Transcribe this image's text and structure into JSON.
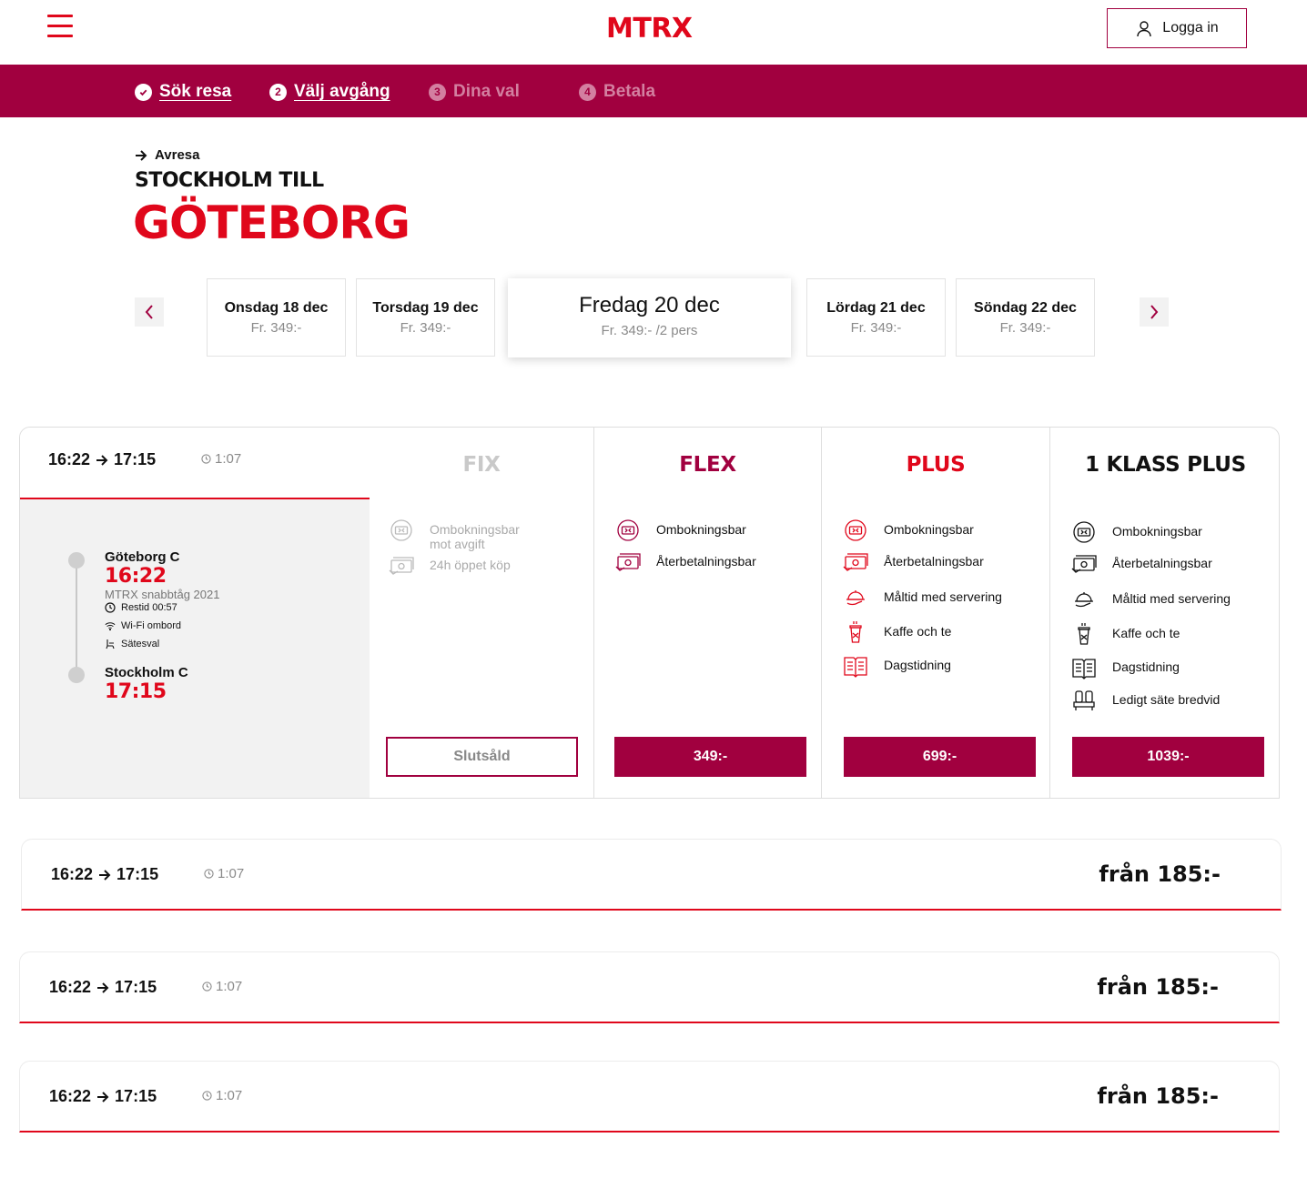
{
  "header": {
    "logo": "MTRX",
    "login_label": "Logga in"
  },
  "steps": [
    {
      "num": "✓",
      "label": "Sök resa",
      "state": "done"
    },
    {
      "num": "2",
      "label": "Välj avgång",
      "state": "current"
    },
    {
      "num": "3",
      "label": "Dina val",
      "state": "upcoming"
    },
    {
      "num": "4",
      "label": "Betala",
      "state": "upcoming"
    }
  ],
  "route": {
    "direction": "Avresa",
    "from": "STOCKHOLM TILL",
    "to": "GÖTEBORG"
  },
  "dates": [
    {
      "day": "Onsdag 18 dec",
      "price": "Fr. 349:-"
    },
    {
      "day": "Torsdag 19 dec",
      "price": "Fr. 349:-"
    },
    {
      "day": "Fredag 20 dec",
      "price": "Fr. 349:- /2 pers",
      "selected": true
    },
    {
      "day": "Lördag 21 dec",
      "price": "Fr. 349:-"
    },
    {
      "day": "Söndag 22 dec",
      "price": "Fr. 349:-"
    }
  ],
  "expanded_departure": {
    "depart": "16:22",
    "arrive": "17:15",
    "duration": "1:07",
    "origin": {
      "station": "Göteborg C",
      "time": "16:22"
    },
    "destination": {
      "station": "Stockholm C",
      "time": "17:15"
    },
    "train": "MTRX snabbtåg 2021",
    "travel_time": "Restid 00:57",
    "amenities": [
      "Wi-Fi ombord",
      "Sätesval"
    ],
    "tiers": [
      {
        "name": "FIX",
        "color": "#c9c9c9",
        "features": [
          {
            "icon": "rebook-ticket-icon",
            "text": "Ombokningsbar mot avgift"
          },
          {
            "icon": "refund-money-icon",
            "text": "24h öppet köp"
          }
        ],
        "button": "Slutsåld",
        "sold_out": true
      },
      {
        "name": "FLEX",
        "color": "#a1003f",
        "features": [
          {
            "icon": "rebook-ticket-icon",
            "text": "Ombokningsbar"
          },
          {
            "icon": "refund-money-icon",
            "text": "Återbetalningsbar"
          }
        ],
        "button": "349:-"
      },
      {
        "name": "PLUS",
        "color": "#e0071b",
        "features": [
          {
            "icon": "rebook-ticket-icon",
            "text": "Ombokningsbar"
          },
          {
            "icon": "refund-money-icon",
            "text": "Återbetalningsbar"
          },
          {
            "icon": "meal-service-icon",
            "text": "Måltid med servering"
          },
          {
            "icon": "coffee-cup-icon",
            "text": "Kaffe och te"
          },
          {
            "icon": "newspaper-icon",
            "text": "Dagstidning"
          }
        ],
        "button": "699:-"
      },
      {
        "name": "1 KLASS PLUS",
        "color": "#111111",
        "features": [
          {
            "icon": "rebook-ticket-icon",
            "text": "Ombokningsbar"
          },
          {
            "icon": "refund-money-icon",
            "text": "Återbetalningsbar"
          },
          {
            "icon": "meal-service-icon",
            "text": "Måltid med servering"
          },
          {
            "icon": "coffee-cup-icon",
            "text": "Kaffe och te"
          },
          {
            "icon": "newspaper-icon",
            "text": "Dagstidning"
          },
          {
            "icon": "empty-seat-icon",
            "text": "Ledigt säte bredvid"
          }
        ],
        "button": "1039:-"
      }
    ]
  },
  "other_departures": [
    {
      "depart": "16:22",
      "arrive": "17:15",
      "duration": "1:07",
      "price": "från 185:-"
    },
    {
      "depart": "16:22",
      "arrive": "17:15",
      "duration": "1:07",
      "price": "från 185:-"
    },
    {
      "depart": "16:22",
      "arrive": "17:15",
      "duration": "1:07",
      "price": "från 185:-"
    }
  ]
}
